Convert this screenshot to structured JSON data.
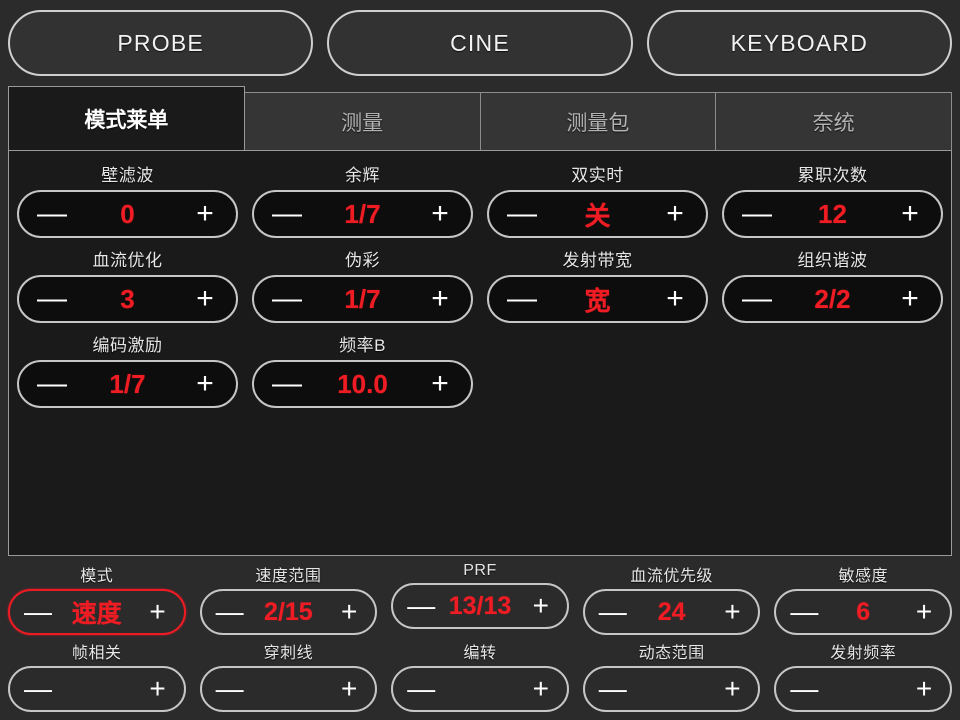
{
  "topbar": {
    "buttons": [
      {
        "label": "PROBE",
        "name": "probe-button"
      },
      {
        "label": "CINE",
        "name": "cine-button"
      },
      {
        "label": "KEYBOARD",
        "name": "keyboard-button"
      }
    ]
  },
  "tabs": [
    {
      "label": "模式莱单",
      "active": true
    },
    {
      "label": "测量",
      "active": false
    },
    {
      "label": "测量包",
      "active": false
    },
    {
      "label": "奈统",
      "active": false
    }
  ],
  "panel": {
    "controls": [
      {
        "label": "壁滤波",
        "value": "0"
      },
      {
        "label": "余辉",
        "value": "1/7"
      },
      {
        "label": "双实时",
        "value": "关"
      },
      {
        "label": "累职次数",
        "value": "12"
      },
      {
        "label": "血流优化",
        "value": "3"
      },
      {
        "label": "伪彩",
        "value": "1/7"
      },
      {
        "label": "发射带宽",
        "value": "宽"
      },
      {
        "label": "组织谐波",
        "value": "2/2"
      },
      {
        "label": "编码激励",
        "value": "1/7"
      },
      {
        "label": "频率B",
        "value": "10.0"
      }
    ]
  },
  "bottombar": {
    "controls": [
      {
        "label": "模式",
        "value": "速度",
        "selected": true
      },
      {
        "label": "速度范围",
        "value": "2/15",
        "selected": false
      },
      {
        "label": "PRF",
        "value": "13/13",
        "selected": false
      },
      {
        "label": "血流优先级",
        "value": "24",
        "selected": false
      },
      {
        "label": "敏感度",
        "value": "6",
        "selected": false
      },
      {
        "label": "帧相关",
        "value": "",
        "selected": false
      },
      {
        "label": "穿刺线",
        "value": "",
        "selected": false
      },
      {
        "label": "编转",
        "value": "",
        "selected": false
      },
      {
        "label": "动态范围",
        "value": "",
        "selected": false
      },
      {
        "label": "发射频率",
        "value": "",
        "selected": false
      }
    ]
  },
  "icons": {
    "minus": "—",
    "plus": "+"
  },
  "colors": {
    "accent_red": "#ef1c24",
    "panel_bg": "#1a1a1a",
    "window_bg": "#2b2b2b",
    "border": "#c6c6c6"
  }
}
